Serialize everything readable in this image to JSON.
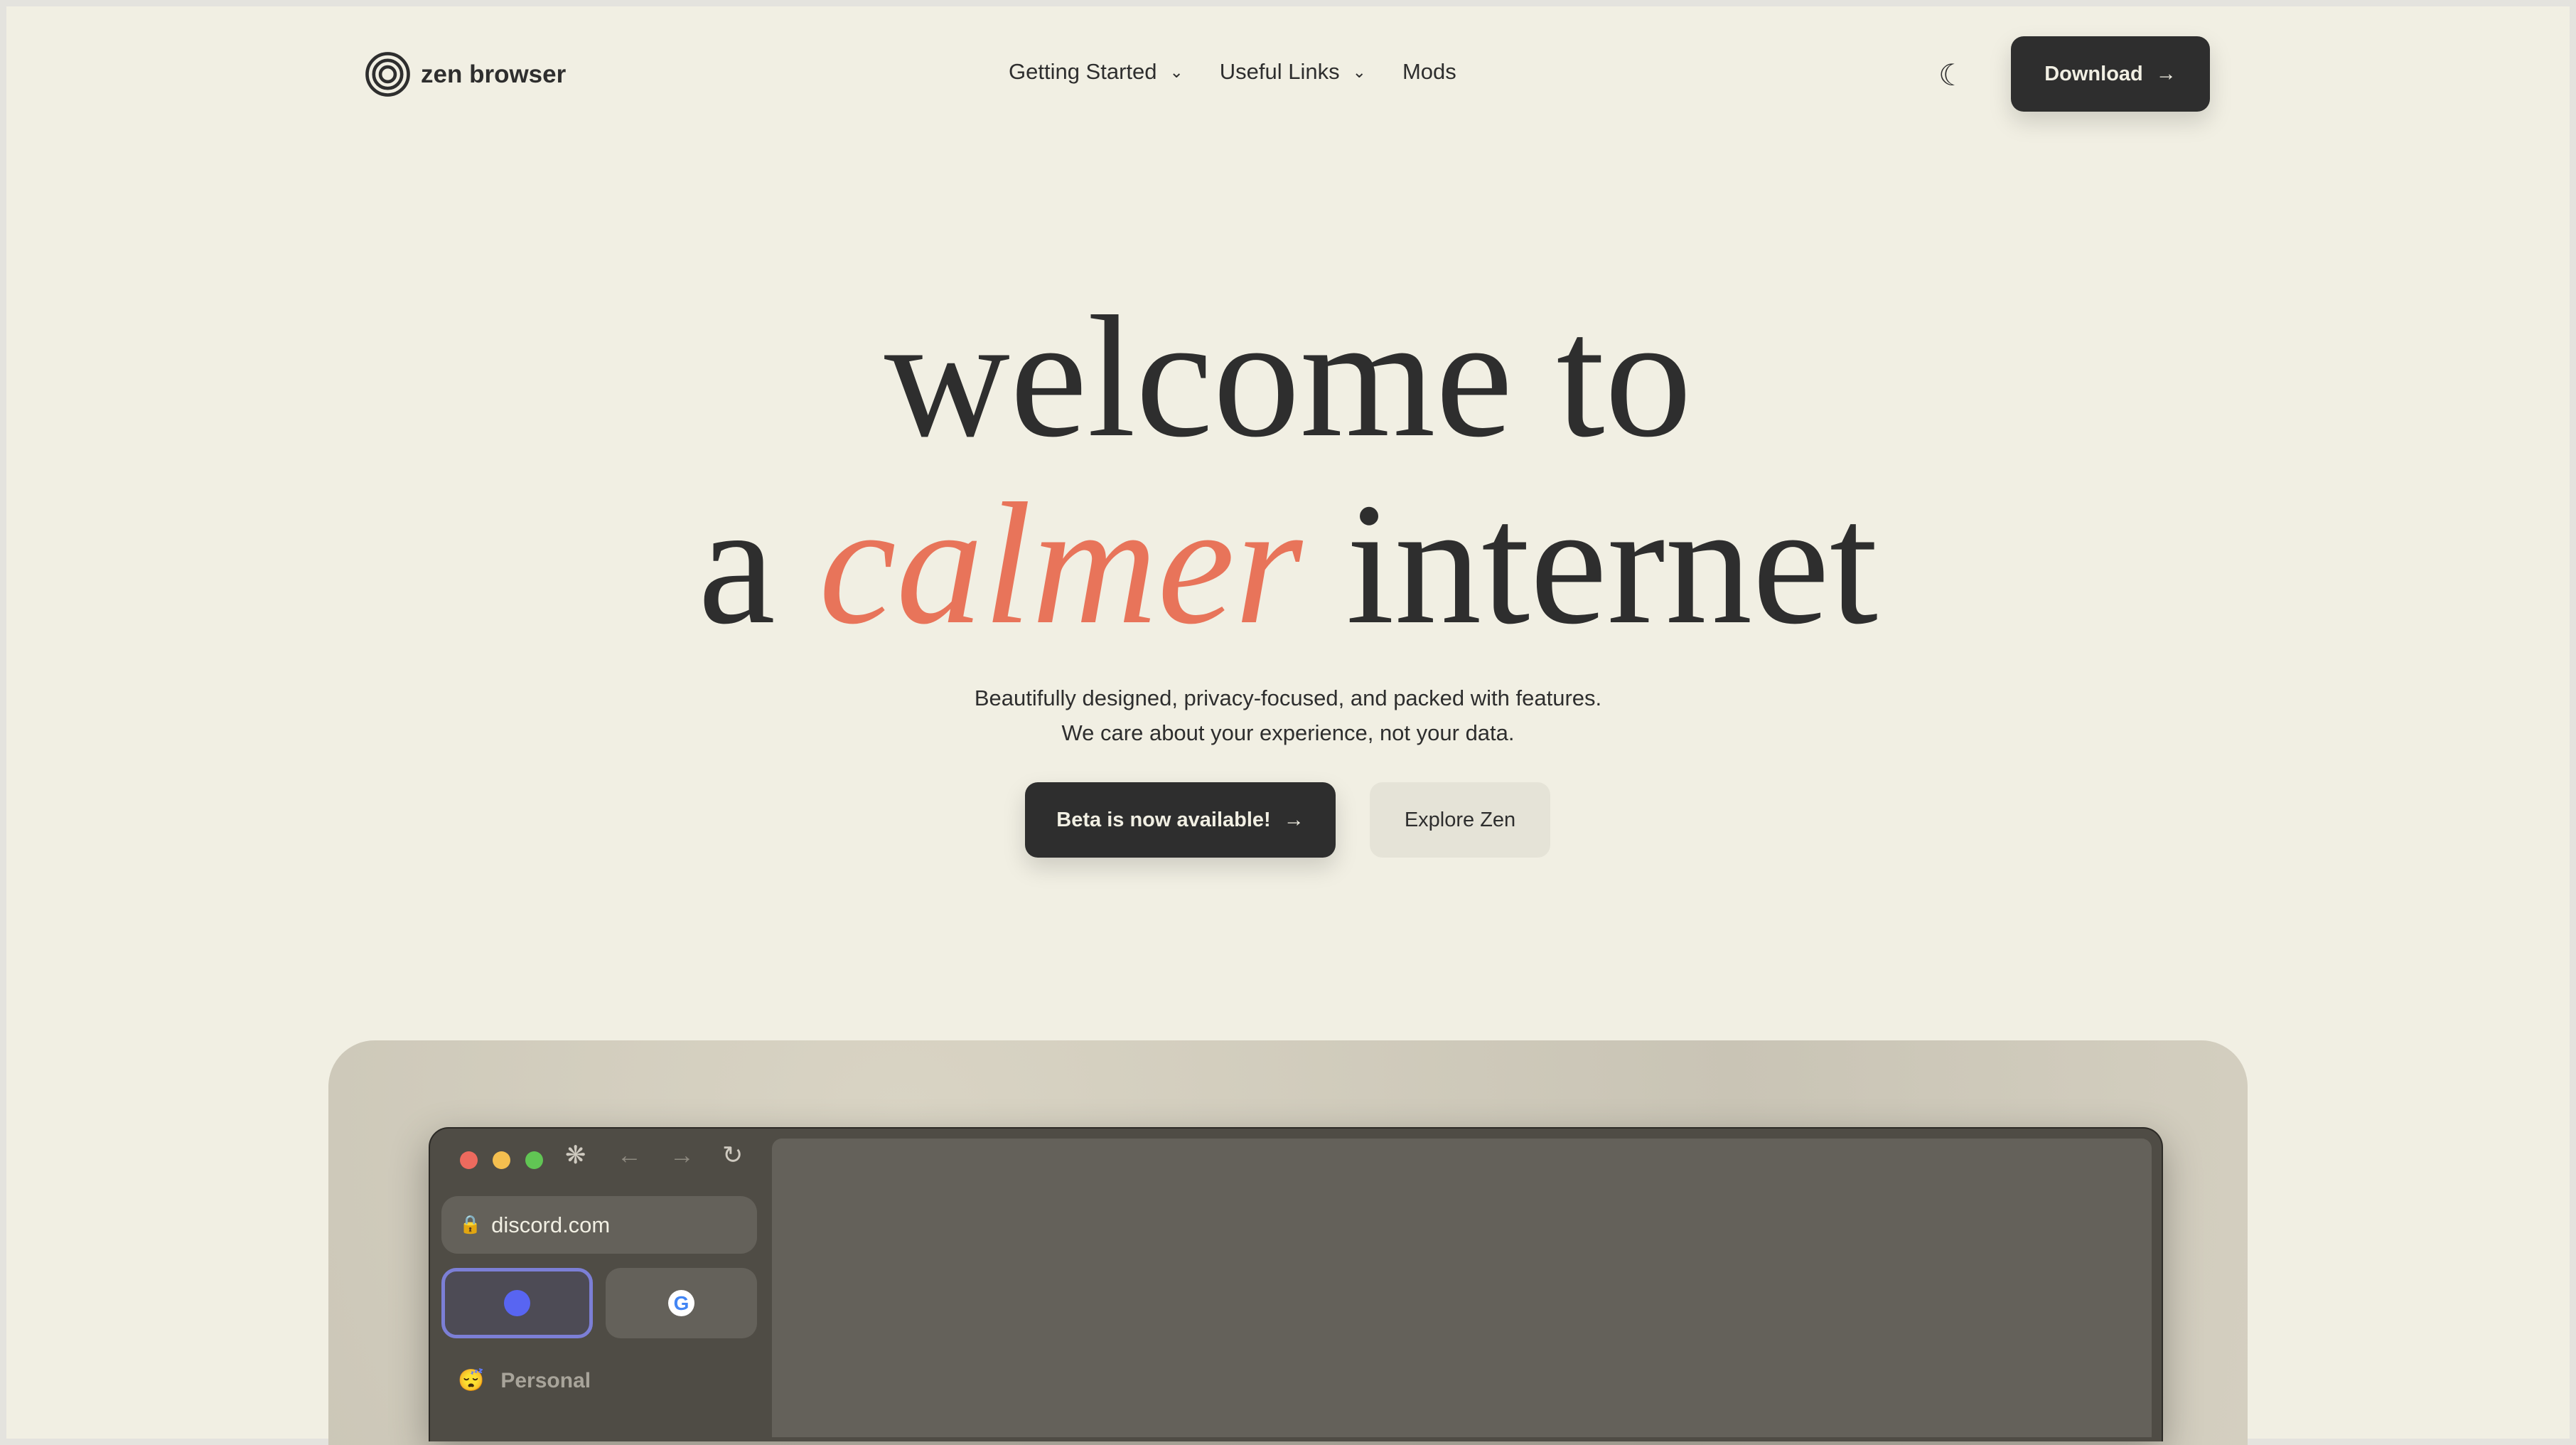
{
  "header": {
    "brand": "zen browser",
    "nav": [
      {
        "label": "Getting Started",
        "dropdown": true
      },
      {
        "label": "Useful Links",
        "dropdown": true
      },
      {
        "label": "Mods",
        "dropdown": false
      }
    ],
    "theme_icon": "moon-icon",
    "download_label": "Download"
  },
  "hero": {
    "line1": "welcome to",
    "line2_pre": "a",
    "line2_accent": "calmer",
    "line2_post": "internet",
    "subtitle1": "Beautifully designed, privacy-focused, and packed with features.",
    "subtitle2": "We care about your experience, not your data.",
    "primary_button": "Beta is now available!",
    "secondary_button": "Explore Zen"
  },
  "colors": {
    "background": "#f1efe3",
    "dark": "#2e2e2e",
    "accent": "#e8745a"
  },
  "mockup": {
    "url": "discord.com",
    "tabs": [
      "discord-icon",
      "google-icon"
    ],
    "workspace": "Personal"
  }
}
